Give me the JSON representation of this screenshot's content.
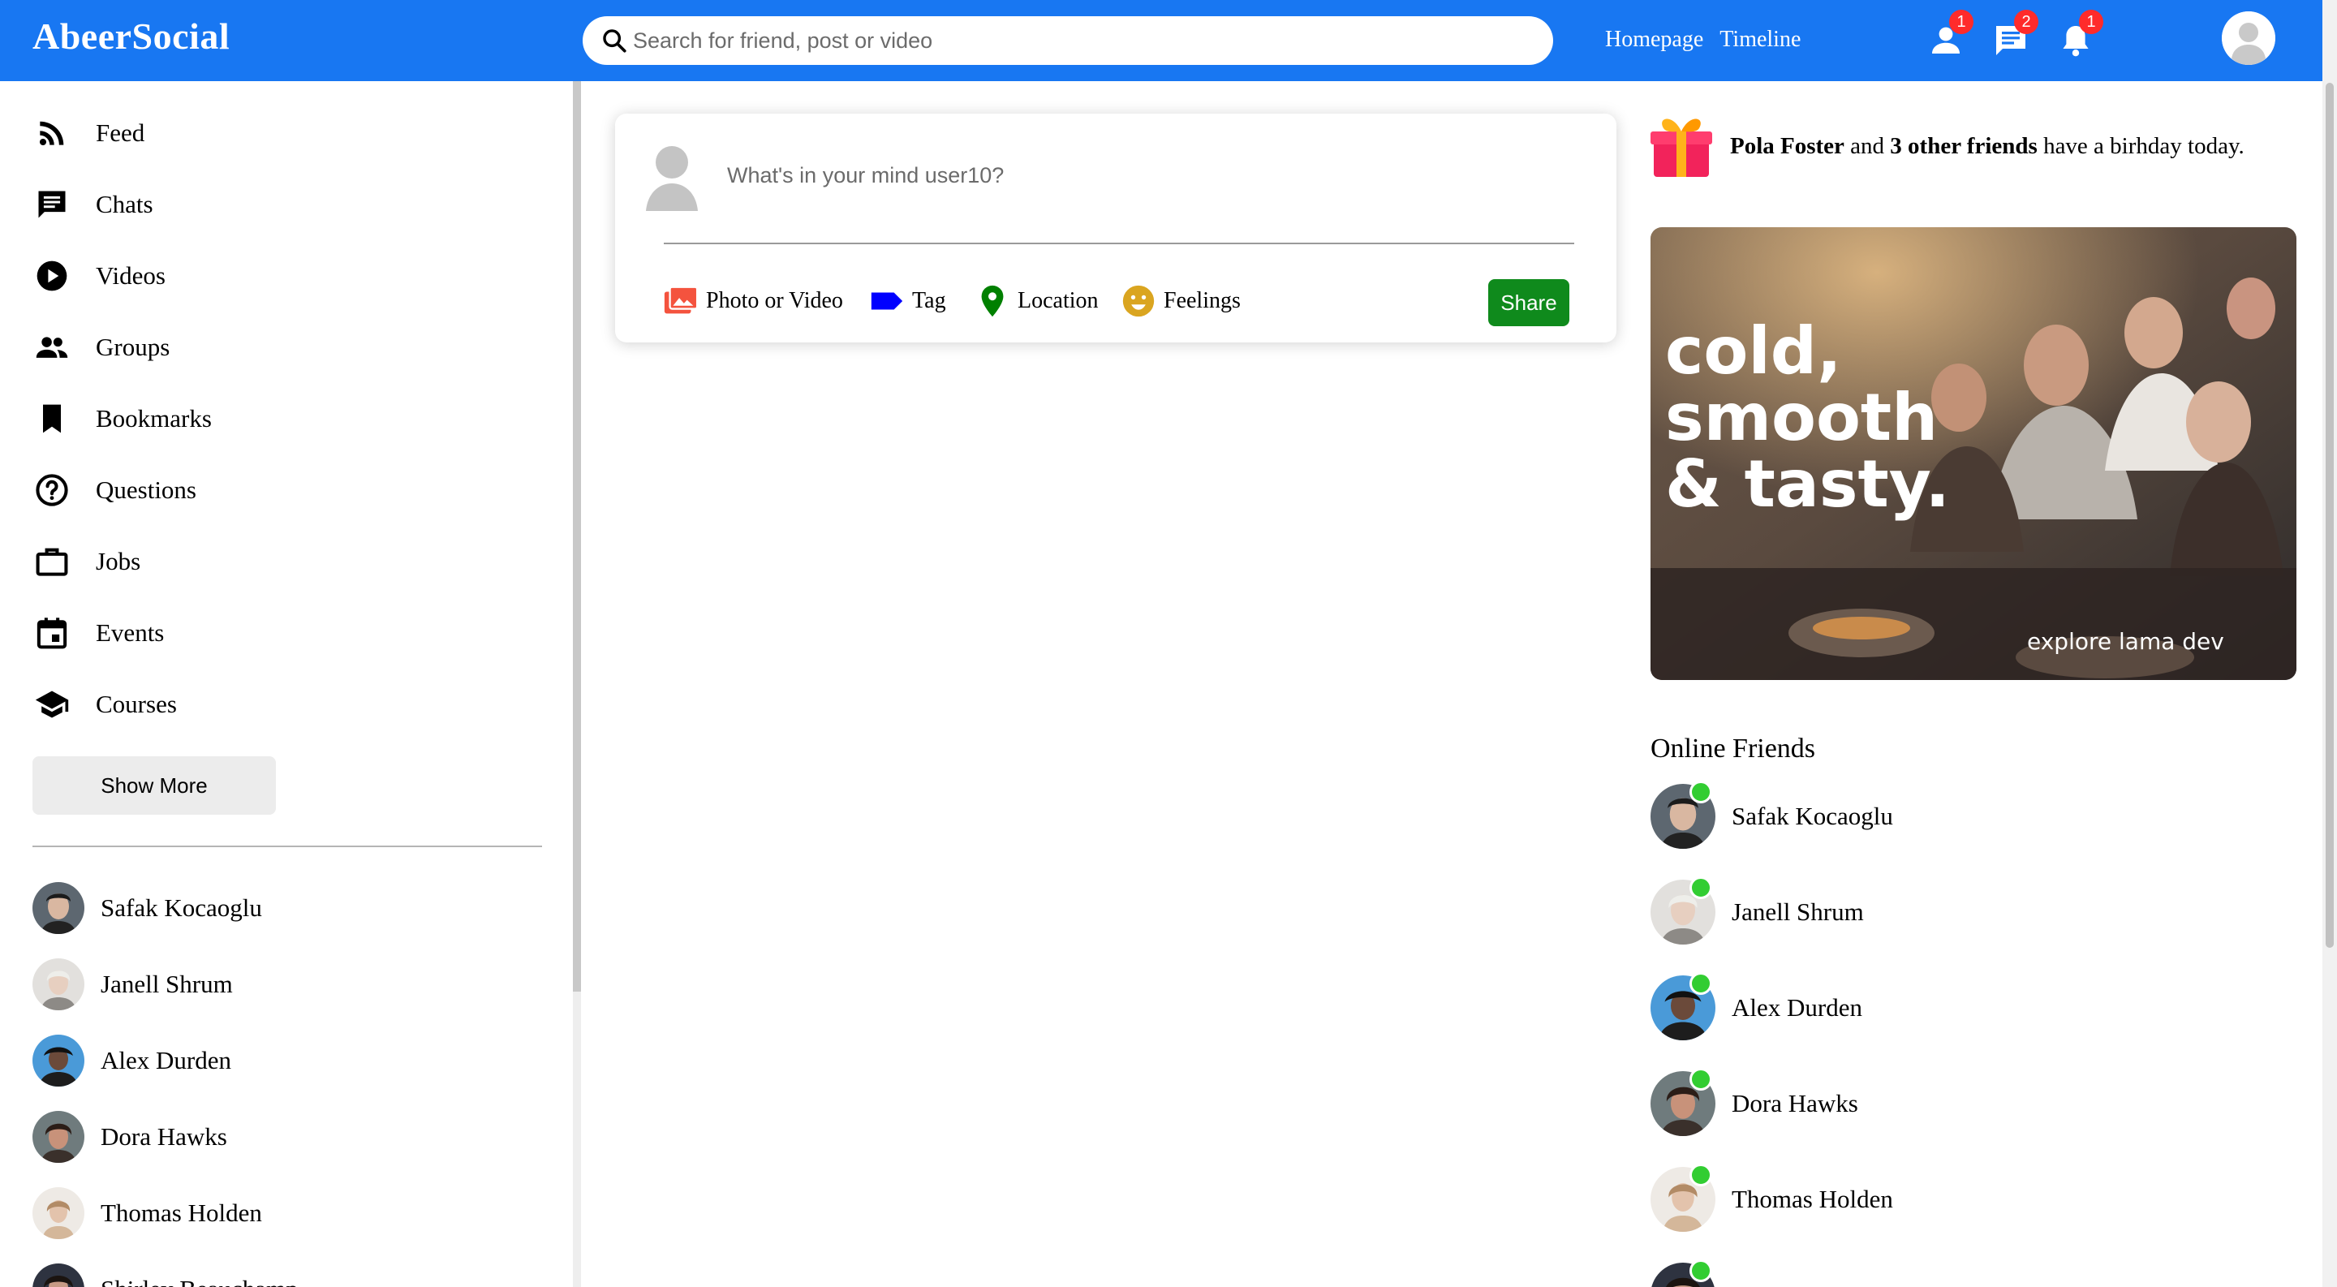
{
  "app": {
    "logo": "AbeerSocial"
  },
  "topbar": {
    "search_placeholder": "Search for friend, post or video",
    "links": [
      "Homepage",
      "Timeline"
    ],
    "badges": {
      "friend_requests": "1",
      "messages": "2",
      "notifications": "1"
    }
  },
  "sidebar": {
    "items": [
      {
        "label": "Feed",
        "icon": "rss-feed-icon"
      },
      {
        "label": "Chats",
        "icon": "chat-icon"
      },
      {
        "label": "Videos",
        "icon": "play-circle-icon"
      },
      {
        "label": "Groups",
        "icon": "group-icon"
      },
      {
        "label": "Bookmarks",
        "icon": "bookmark-icon"
      },
      {
        "label": "Questions",
        "icon": "help-circle-icon"
      },
      {
        "label": "Jobs",
        "icon": "briefcase-icon"
      },
      {
        "label": "Events",
        "icon": "calendar-icon"
      },
      {
        "label": "Courses",
        "icon": "graduation-cap-icon"
      }
    ],
    "show_more": "Show More",
    "friends": [
      "Safak Kocaoglu",
      "Janell Shrum",
      "Alex Durden",
      "Dora Hawks",
      "Thomas Holden",
      "Shirley Beauchamp"
    ]
  },
  "share": {
    "placeholder": "What's in your mind user10?",
    "options": [
      "Photo or Video",
      "Tag",
      "Location",
      "Feelings"
    ],
    "button": "Share",
    "colors": {
      "photo": "#f4533e",
      "tag": "#0000ff",
      "location": "#008000",
      "feelings": "#daa520",
      "share": "#0f8a1c"
    }
  },
  "rightbar": {
    "birthday": {
      "name": "Pola Foster",
      "connector": "and",
      "others": "3 other friends",
      "suffix": "have a birhday today."
    },
    "ad": {
      "headline": [
        "cold,",
        "smooth",
        "& tasty."
      ],
      "tagline": "explore lama dev"
    },
    "online_title": "Online Friends",
    "online_friends": [
      "Safak Kocaoglu",
      "Janell Shrum",
      "Alex Durden",
      "Dora Hawks",
      "Thomas Holden"
    ]
  },
  "colors": {
    "brand": "#1877f2",
    "online": "#32cd32",
    "badge": "#ff2b2b"
  }
}
